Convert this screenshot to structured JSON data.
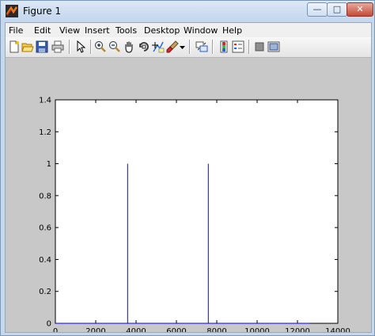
{
  "window": {
    "title": "Figure 1"
  },
  "menu": [
    "File",
    "Edit",
    "View",
    "Insert",
    "Tools",
    "Desktop",
    "Window",
    "Help"
  ],
  "toolbar": {
    "icons": [
      "new-figure-icon",
      "open-file-icon",
      "save-icon",
      "print-icon",
      "edit-plot-arrow-icon",
      "zoom-in-icon",
      "zoom-out-icon",
      "pan-hand-icon",
      "rotate-3d-icon",
      "data-cursor-icon",
      "brush-icon",
      "brush-dropdown-icon",
      "link-plot-icon",
      "insert-colorbar-icon",
      "insert-legend-icon",
      "hide-plot-tools-icon",
      "show-plot-tools-icon"
    ]
  },
  "colors": {
    "series": "#0000ff",
    "figure_bg": "#c8c8c8",
    "axes_bg": "#ffffff"
  },
  "chart_data": {
    "type": "line",
    "title": "",
    "xlabel": "",
    "ylabel": "",
    "xlim": [
      0,
      14000
    ],
    "ylim": [
      0,
      1.4
    ],
    "xticks": [
      0,
      2000,
      4000,
      6000,
      8000,
      10000,
      12000,
      14000
    ],
    "xtick_labels": [
      "0",
      "2000",
      "4000",
      "6000",
      "8000",
      "10000",
      "12000",
      "14000"
    ],
    "yticks": [
      0,
      0.2,
      0.4,
      0.6,
      0.8,
      1,
      1.2,
      1.4
    ],
    "ytick_labels": [
      "0",
      "0.2",
      "0.4",
      "0.6",
      "0.8",
      "1",
      "1.2",
      "1.4"
    ],
    "grid": false,
    "series": [
      {
        "color": "#0000ff",
        "x": [
          0,
          3580,
          3580,
          3580,
          7580,
          7580,
          7580,
          12600
        ],
        "y": [
          0,
          0,
          1,
          0,
          0,
          1,
          0,
          0
        ]
      }
    ]
  }
}
